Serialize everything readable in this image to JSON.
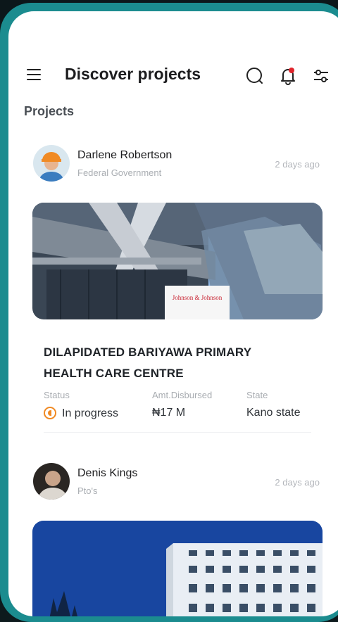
{
  "header": {
    "title": "Discover projects"
  },
  "section": {
    "label": "Projects"
  },
  "projects": [
    {
      "author": "Darlene Robertson",
      "org": "Federal Government",
      "time": "2 days ago",
      "title": "DILAPIDATED BARIYAWA PRIMARY HEALTH CARE CENTRE",
      "status_label": "Status",
      "status": "In progress",
      "amount_label": "Amt.Disbursed",
      "amount": "₦17 M",
      "state_label": "State",
      "state": "Kano state",
      "photo_sign": "Johnson & Johnson"
    },
    {
      "author": "Denis Kings",
      "org": "Pto's",
      "time": "2 days ago"
    }
  ],
  "colors": {
    "frame": "#1b8c8f",
    "status_accent": "#f08a24",
    "bell_dot": "#e0242b"
  }
}
